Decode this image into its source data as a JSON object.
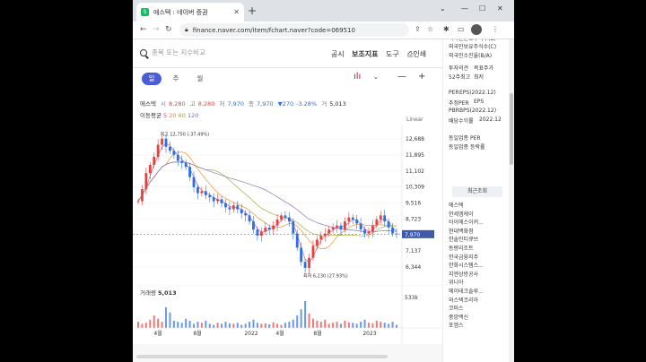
{
  "browser": {
    "tab_title": "에스텍 : 네이버 증권",
    "favicon_letter": "S",
    "url": "finance.naver.com/item/fchart.naver?code=069510"
  },
  "toolbar": {
    "search_placeholder": "종목 또는 지수비교",
    "notice": "공시",
    "indicator": "보조지표",
    "tools": "도구",
    "print": "인쇄"
  },
  "periods": [
    {
      "label": "일",
      "active": true
    },
    {
      "label": "주",
      "active": false
    },
    {
      "label": "월",
      "active": false
    }
  ],
  "quote": {
    "name": "에스텍",
    "open_label": "시",
    "open": "8,280",
    "high_label": "고",
    "high": "8,280",
    "low_label": "저",
    "low": "7,970",
    "close_label": "종",
    "close": "7,970",
    "change": "▼270",
    "change_pct": "-3.28%",
    "volume_label": "거",
    "volume": "5,013"
  },
  "moving_average": {
    "label": "이동평균",
    "ma5": "5",
    "ma20": "20",
    "ma60": "60",
    "ma120": "120"
  },
  "scale_label": "Linear",
  "chart_data": {
    "type": "line",
    "title": "",
    "y_ticks": [
      12688,
      11895,
      11102,
      10309,
      9516,
      8723,
      7137,
      6344
    ],
    "current_price": 7970,
    "current_price_label": "7,970",
    "x_ticks": [
      "4월",
      "8월",
      "2022",
      "4월",
      "8월",
      "2023"
    ],
    "max_annotation": "최고 12,750 (-37.49%)",
    "min_annotation": "최저 6,230 (27.93%)",
    "series": [
      {
        "name": "종가",
        "values": [
          9600,
          10200,
          11000,
          11400,
          11800,
          12400,
          12700,
          12300,
          12100,
          11900,
          11600,
          11500,
          11300,
          10800,
          10300,
          10000,
          10100,
          9900,
          9800,
          9600,
          9700,
          9500,
          9300,
          9200,
          9400,
          9200,
          9000,
          8900,
          8600,
          8200,
          7900,
          8100,
          8300,
          8200,
          8400,
          8700,
          8900,
          8800,
          8600,
          8000,
          7300,
          6600,
          6300,
          6800,
          7400,
          7700,
          7900,
          8000,
          8200,
          8300,
          8400,
          8200,
          8600,
          8800,
          8700,
          8500,
          8200,
          8000,
          8100,
          8400,
          8700,
          8900,
          8600,
          8300,
          8000,
          7970
        ]
      }
    ],
    "volume_label": "거래량",
    "volume_value": "5,013",
    "volume_tick": "533k",
    "volume": [
      60,
      40,
      50,
      80,
      120,
      90,
      60,
      200,
      150,
      70,
      60,
      50,
      90,
      70,
      40,
      60,
      50,
      70,
      40,
      30,
      50,
      40,
      60,
      45,
      40,
      50,
      30,
      40,
      60,
      80,
      50,
      40,
      45,
      35,
      55,
      40,
      30,
      50,
      60,
      80,
      120,
      180,
      260,
      140,
      90,
      70,
      60,
      80,
      40,
      50,
      60,
      40,
      70,
      55,
      50,
      40,
      60,
      80,
      50,
      45,
      70,
      60,
      50,
      40,
      60,
      30
    ]
  },
  "right_panel": {
    "lines": [
      "외국인한도주식수(B)",
      "외국인보유주식수(C)",
      "외국인소진율(B/A)",
      "투자의견",
      "목표주가",
      "52주최고",
      "최저",
      "PER",
      "EPS(2022.12)",
      "추정PER",
      "EPS",
      "PBR",
      "BPS(2022.12)",
      "배당수익률",
      "2022.12",
      "동일업종 PER",
      "동일업종 등락률"
    ],
    "recent_header": "최근조회",
    "recent": [
      "에스텍",
      "한세엠케이",
      "아이에스이커...",
      "현대백화점",
      "한솔인티큐브",
      "동량리조트",
      "한국금융지주",
      "한화시스템스...",
      "지엔상방공사",
      "위니아",
      "에이테크솔루...",
      "와스텍코리아",
      "코퍼스",
      "중앙백신",
      "포엠스"
    ]
  },
  "colors": {
    "up": "#e8403b",
    "down": "#2a6ee8",
    "accent": "#4a5cd6",
    "price_tag": "#3f5aa8"
  }
}
